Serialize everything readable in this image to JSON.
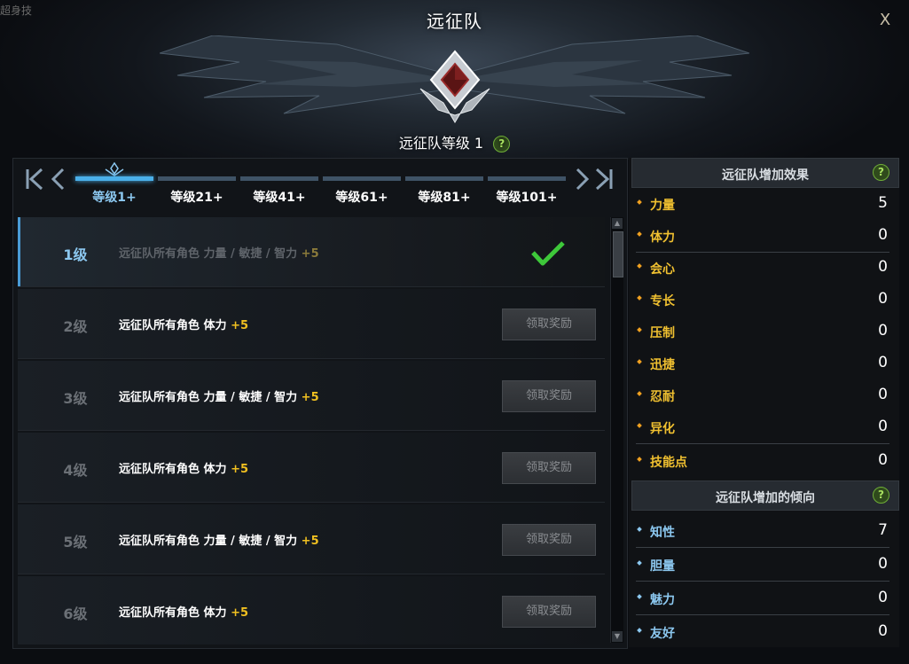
{
  "corner_text": "超身技",
  "title": "远征队",
  "close_label": "X",
  "level_title": "远征队等级 1",
  "help_label": "?",
  "tabs": [
    {
      "label": "等级1+"
    },
    {
      "label": "等级21+"
    },
    {
      "label": "等级41+"
    },
    {
      "label": "等级61+"
    },
    {
      "label": "等级81+"
    },
    {
      "label": "等级101+"
    }
  ],
  "nav": {
    "first": "K",
    "prev": "‹",
    "next": "›",
    "last": "K"
  },
  "rewards": [
    {
      "level": "1级",
      "text": "远征队所有角色 力量 / 敏捷 / 智力",
      "bonus": "+5",
      "claimed": true
    },
    {
      "level": "2级",
      "text": "远征队所有角色 体力",
      "bonus": "+5",
      "claimed": false
    },
    {
      "level": "3级",
      "text": "远征队所有角色 力量 / 敏捷 / 智力",
      "bonus": "+5",
      "claimed": false
    },
    {
      "level": "4级",
      "text": "远征队所有角色 体力",
      "bonus": "+5",
      "claimed": false
    },
    {
      "level": "5级",
      "text": "远征队所有角色 力量 / 敏捷 / 智力",
      "bonus": "+5",
      "claimed": false
    },
    {
      "level": "6级",
      "text": "远征队所有角色 体力",
      "bonus": "+5",
      "claimed": false
    }
  ],
  "claim_label": "领取奖励",
  "effects": {
    "title": "远征队增加效果",
    "stats": [
      {
        "name": "力量",
        "value": "5"
      },
      {
        "name": "体力",
        "value": "0"
      },
      {
        "name": "会心",
        "value": "0"
      },
      {
        "name": "专长",
        "value": "0"
      },
      {
        "name": "压制",
        "value": "0"
      },
      {
        "name": "迅捷",
        "value": "0"
      },
      {
        "name": "忍耐",
        "value": "0"
      },
      {
        "name": "异化",
        "value": "0"
      },
      {
        "name": "技能点",
        "value": "0"
      }
    ]
  },
  "tendencies": {
    "title": "远征队增加的倾向",
    "stats": [
      {
        "name": "知性",
        "value": "7"
      },
      {
        "name": "胆量",
        "value": "0"
      },
      {
        "name": "魅力",
        "value": "0"
      },
      {
        "name": "友好",
        "value": "0"
      }
    ]
  },
  "colors": {
    "accent": "#4ab0ea",
    "bonus": "#f0c020",
    "check": "#3ec83a"
  }
}
